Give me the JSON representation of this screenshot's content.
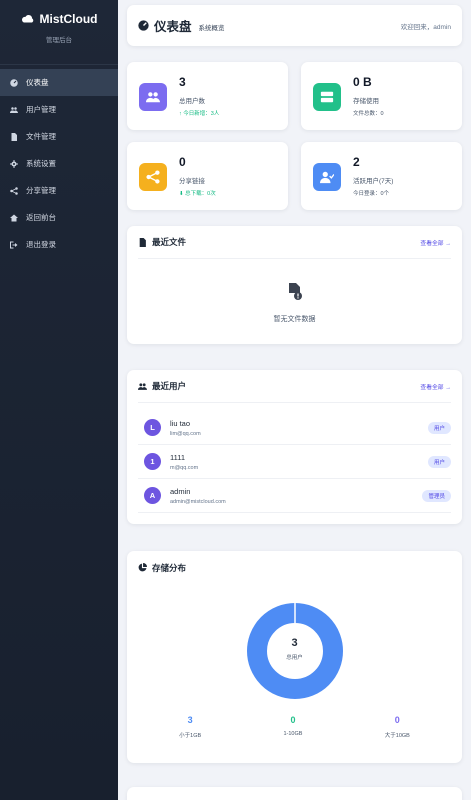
{
  "sidebar": {
    "brand": "MistCloud",
    "subtitle": "管理后台",
    "items": [
      {
        "label": "仪表盘",
        "icon": "dashboard-icon",
        "active": true
      },
      {
        "label": "用户管理",
        "icon": "users-icon",
        "active": false
      },
      {
        "label": "文件管理",
        "icon": "file-icon",
        "active": false
      },
      {
        "label": "系统设置",
        "icon": "gear-icon",
        "active": false
      },
      {
        "label": "分享管理",
        "icon": "share-icon",
        "active": false
      },
      {
        "label": "返回前台",
        "icon": "home-icon",
        "active": false
      },
      {
        "label": "退出登录",
        "icon": "logout-icon",
        "active": false
      }
    ]
  },
  "header": {
    "title": "仪表盘",
    "tag": "系统概览",
    "welcome": "欢迎回来，admin"
  },
  "stats": [
    {
      "value": "3",
      "label": "总用户数",
      "sub": "今日新增：3人",
      "color": "#7c6cf0"
    },
    {
      "value": "0 B",
      "label": "存储使用",
      "sub": "文件总数：0",
      "color": "#22c08a"
    },
    {
      "value": "0",
      "label": "分享链接",
      "sub": "总下载：0次",
      "color": "#f5b01e"
    },
    {
      "value": "2",
      "label": "活跃用户(7天)",
      "sub": "今日登录：0个",
      "color": "#4e8cf4"
    }
  ],
  "recent_files": {
    "title": "最近文件",
    "more": "查看全部 →",
    "empty": "暂无文件数据"
  },
  "recent_users": {
    "title": "最近用户",
    "more": "查看全部 →",
    "rows": [
      {
        "initial": "L",
        "name": "liu tao",
        "email": "lim@qq.com",
        "role": "用户"
      },
      {
        "initial": "1",
        "name": "1111",
        "email": "m@qq.com",
        "role": "用户"
      },
      {
        "initial": "A",
        "name": "admin",
        "email": "admin@mistcloud.com",
        "role": "管理员"
      }
    ]
  },
  "storage": {
    "title": "存储分布",
    "center_value": "3",
    "center_label": "总用户",
    "buckets": [
      {
        "value": "3",
        "label": "小于1GB",
        "color": "#4e8cf4"
      },
      {
        "value": "0",
        "label": "1-10GB",
        "color": "#22c08a"
      },
      {
        "value": "0",
        "label": "大于10GB",
        "color": "#7c6cf0"
      }
    ]
  },
  "colors": {
    "accent": "#4f46e5",
    "donut": "#4e8cf4",
    "sidebar_bg": "#1e2737"
  }
}
